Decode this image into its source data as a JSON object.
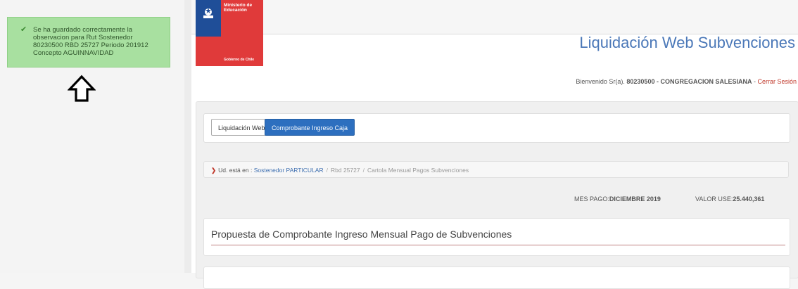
{
  "toast": {
    "message": "Se ha guardado correctamente la\nobservacion para Rut Sostenedor\n80230500 RBD 25727 Periodo 201912\nConcepto AGUINNAVIDAD",
    "icon": "check-icon",
    "color": "#a8e0a0"
  },
  "logo": {
    "ministry": "Ministerio de\nEducación",
    "government": "Gobierno de Chile"
  },
  "header": {
    "app_title": "Liquidación Web Subvenciones"
  },
  "welcome": {
    "prefix": "Bienvenido Sr(a). ",
    "user": "80230500 - CONGREGACION SALESIANA",
    "separator": " - ",
    "logout": "Cerrar Sesión"
  },
  "buttons": {
    "liquidacion": "Liquidación Web",
    "comprobante": "Comprobante Ingreso Caja"
  },
  "breadcrumb": {
    "intro": "Ud. está en :",
    "items": [
      "Sostenedor PARTICULAR",
      "Rbd 25727",
      "Cartola Mensual Pagos Subvenciones"
    ]
  },
  "payment": {
    "month_label": "MES PAGO:",
    "month_value": "DICIEMBRE 2019",
    "value_label": "VALOR USE:",
    "value_value": "25.440,361"
  },
  "proposal": {
    "title": "Propuesta de Comprobante Ingreso Mensual Pago de Subvenciones"
  },
  "colors": {
    "accent": "#2d6fbf",
    "title": "#4b78b8",
    "logout": "#c0392b"
  }
}
